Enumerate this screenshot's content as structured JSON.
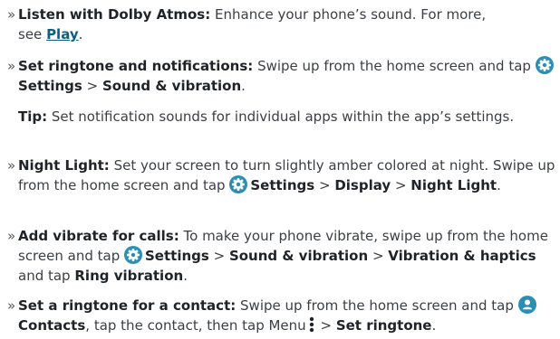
{
  "bullet_char": "»",
  "items": [
    {
      "title": "Listen with Dolby Atmos:",
      "text_1": "Enhance your phone’s sound. For more,",
      "text_2": "see",
      "link": "Play",
      "text_3": "."
    },
    {
      "title": "Set ringtone and notifications:",
      "text_1": "Swipe up from the home screen and tap",
      "settings": "Settings",
      "sep": ">",
      "target": "Sound & vibration",
      "end": "."
    },
    {
      "tip_label": "Tip:",
      "tip_text": "Set notification sounds for individual apps within the app’s settings."
    },
    {
      "title": "Night Light:",
      "text_1": "Set your screen to turn slightly amber colored at night. Swipe up from the home screen and tap",
      "settings": "Settings",
      "sep1": ">",
      "display": "Display",
      "sep2": ">",
      "night": "Night Light",
      "end": "."
    },
    {
      "title": "Add vibrate for calls:",
      "text_1": "To make your phone vibrate, swipe up from the home screen and tap",
      "settings": "Settings",
      "sep1": ">",
      "sound": "Sound & vibration",
      "sep2": ">",
      "vib": "Vibration & haptics",
      "text_2": "and tap",
      "ring": "Ring vibration",
      "end": "."
    },
    {
      "title": "Set a ringtone for a contact:",
      "text_1": "Swipe up from the home screen and tap",
      "contacts": "Contacts",
      "text_2": ", tap the contact, then tap Menu",
      "sep": ">",
      "set_ringtone": "Set ringtone",
      "end": "."
    }
  ],
  "icons": {
    "settings": "settings-gear-icon",
    "contacts": "contacts-person-icon",
    "menu": "menu-vertical-dots-icon"
  },
  "colors": {
    "link": "#0b5f7f",
    "icon_bg": "#2b8fb5"
  }
}
